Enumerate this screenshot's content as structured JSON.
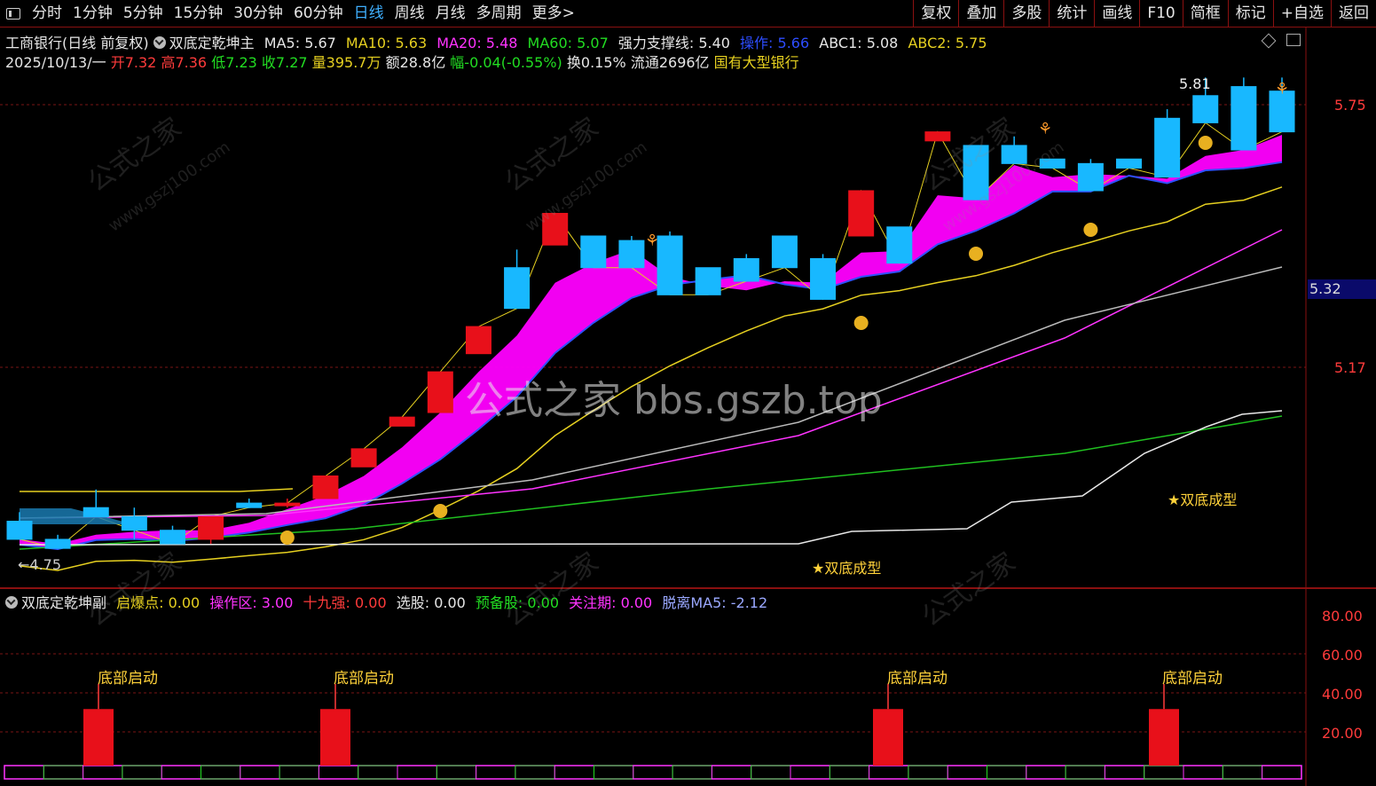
{
  "toolbar": {
    "periods": [
      "分时",
      "1分钟",
      "5分钟",
      "15分钟",
      "30分钟",
      "60分钟",
      "日线",
      "周线",
      "月线",
      "多周期",
      "更多>"
    ],
    "active_period": "日线",
    "right_buttons": [
      "复权",
      "叠加",
      "多股",
      "统计",
      "画线",
      "F10",
      "简框",
      "标记",
      "+自选",
      "返回"
    ]
  },
  "header": {
    "stock": "工商银行(日线 前复权)",
    "indicator_name": "双底定乾坤主",
    "ma5": "MA5: 5.67",
    "ma10": "MA10: 5.63",
    "ma20": "MA20: 5.48",
    "ma60": "MA60: 5.07",
    "support": "强力支撑线: 5.40",
    "operate": "操作: 5.66",
    "abc1": "ABC1: 5.08",
    "abc2": "ABC2: 5.75"
  },
  "quote": {
    "date": "2025/10/13/一",
    "open": "开7.32",
    "high": "高7.36",
    "low": "低7.23",
    "close": "收7.27",
    "volume": "量395.7万",
    "amount": "额28.8亿",
    "change": "幅-0.04(-0.55%)",
    "turnover": "换0.15%",
    "float_cap": "流通2696亿",
    "sector": "国有大型银行"
  },
  "price_axis": [
    "5.75",
    "5.32",
    "5.17"
  ],
  "highlight_price": "5.32",
  "high_marker": "5.81",
  "low_marker": "←4.75",
  "annotations": [
    "★双底成型",
    "★双底成型"
  ],
  "watermark": "公式之家 bbs.gszb.top",
  "wm_small": "公式之家",
  "wm_url": "www.gszj100.com",
  "sub": {
    "name": "双底定乾坤副",
    "qibao": "启爆点: 0.00",
    "caozuo": "操作区: 3.00",
    "shijiu": "十九强: 0.00",
    "xuangu": "选股: 0.00",
    "yubei": "预备股: 0.00",
    "guanzhu": "关注期: 0.00",
    "tuoli": "脱离MA5: -2.12",
    "axis": [
      "80.00",
      "60.00",
      "40.00",
      "20.00"
    ],
    "signal_label": "底部启动"
  },
  "colors": {
    "up": "#e8101a",
    "down": "#18b8ff",
    "band": "#ff00ff",
    "ma_green": "#20c020",
    "ma_yellow": "#e6d020",
    "frame": "#8a1010"
  },
  "chart_data": {
    "type": "candlestick",
    "price_axis_ticks": [
      5.75,
      5.32,
      5.17
    ],
    "candles_ohlc": [
      [
        4.83,
        4.85,
        4.79,
        4.79
      ],
      [
        4.79,
        4.8,
        4.77,
        4.77
      ],
      [
        4.86,
        4.9,
        4.84,
        4.84
      ],
      [
        4.84,
        4.86,
        4.79,
        4.81
      ],
      [
        4.81,
        4.82,
        4.78,
        4.78
      ],
      [
        4.79,
        4.84,
        4.78,
        4.84
      ],
      [
        4.87,
        4.88,
        4.86,
        4.86
      ],
      [
        4.87,
        4.88,
        4.86,
        4.87
      ],
      [
        4.88,
        4.93,
        4.88,
        4.93
      ],
      [
        4.95,
        4.99,
        4.95,
        4.99
      ],
      [
        5.04,
        5.06,
        5.04,
        5.06
      ],
      [
        5.07,
        5.16,
        5.07,
        5.16
      ],
      [
        5.2,
        5.26,
        5.2,
        5.26
      ],
      [
        5.39,
        5.43,
        5.3,
        5.3
      ],
      [
        5.44,
        5.51,
        5.44,
        5.51
      ],
      [
        5.46,
        5.46,
        5.39,
        5.39
      ],
      [
        5.45,
        5.46,
        5.39,
        5.39
      ],
      [
        5.46,
        5.47,
        5.33,
        5.33
      ],
      [
        5.39,
        5.39,
        5.33,
        5.33
      ],
      [
        5.41,
        5.42,
        5.36,
        5.36
      ],
      [
        5.46,
        5.46,
        5.39,
        5.39
      ],
      [
        5.41,
        5.42,
        5.32,
        5.32
      ],
      [
        5.46,
        5.56,
        5.46,
        5.56
      ],
      [
        5.48,
        5.48,
        5.4,
        5.4
      ],
      [
        5.67,
        5.68,
        5.67,
        5.69
      ],
      [
        5.66,
        5.66,
        5.54,
        5.54
      ],
      [
        5.66,
        5.68,
        5.62,
        5.62
      ],
      [
        5.63,
        5.63,
        5.61,
        5.61
      ],
      [
        5.62,
        5.63,
        5.56,
        5.56
      ],
      [
        5.63,
        5.63,
        5.61,
        5.61
      ],
      [
        5.72,
        5.74,
        5.59,
        5.59
      ],
      [
        5.77,
        5.81,
        5.71,
        5.71
      ],
      [
        5.79,
        5.81,
        5.65,
        5.65
      ],
      [
        5.78,
        5.81,
        5.69,
        5.69
      ]
    ],
    "signals_x_index": [
      2,
      8,
      22,
      29
    ],
    "signal_value": 30
  }
}
